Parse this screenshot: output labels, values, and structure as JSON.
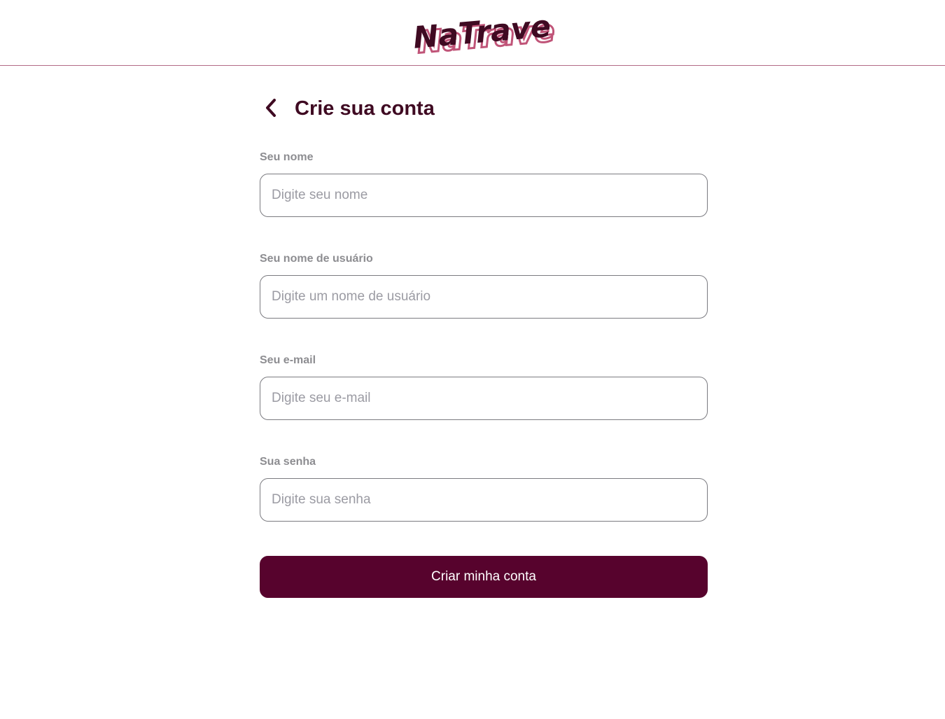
{
  "header": {
    "logo_text": "NaTrave",
    "colors": {
      "logo_primary": "#3f0a22",
      "logo_shadow": "#c05478",
      "divider": "#b36a86"
    }
  },
  "page": {
    "title": "Crie sua conta",
    "back_icon": "chevron-left-icon"
  },
  "form": {
    "fields": [
      {
        "label": "Seu nome",
        "placeholder": "Digite seu nome",
        "value": ""
      },
      {
        "label": "Seu nome de usuário",
        "placeholder": "Digite um nome de usuário",
        "value": ""
      },
      {
        "label": "Seu e-mail",
        "placeholder": "Digite seu e-mail",
        "value": ""
      },
      {
        "label": "Sua senha",
        "placeholder": "Digite sua senha",
        "value": ""
      }
    ],
    "submit_label": "Criar minha conta",
    "colors": {
      "submit_background": "#57032d",
      "submit_text": "#ffffff",
      "label": "#8d8d91",
      "input_border": "#7b7b80",
      "title": "#3f0a22"
    }
  }
}
